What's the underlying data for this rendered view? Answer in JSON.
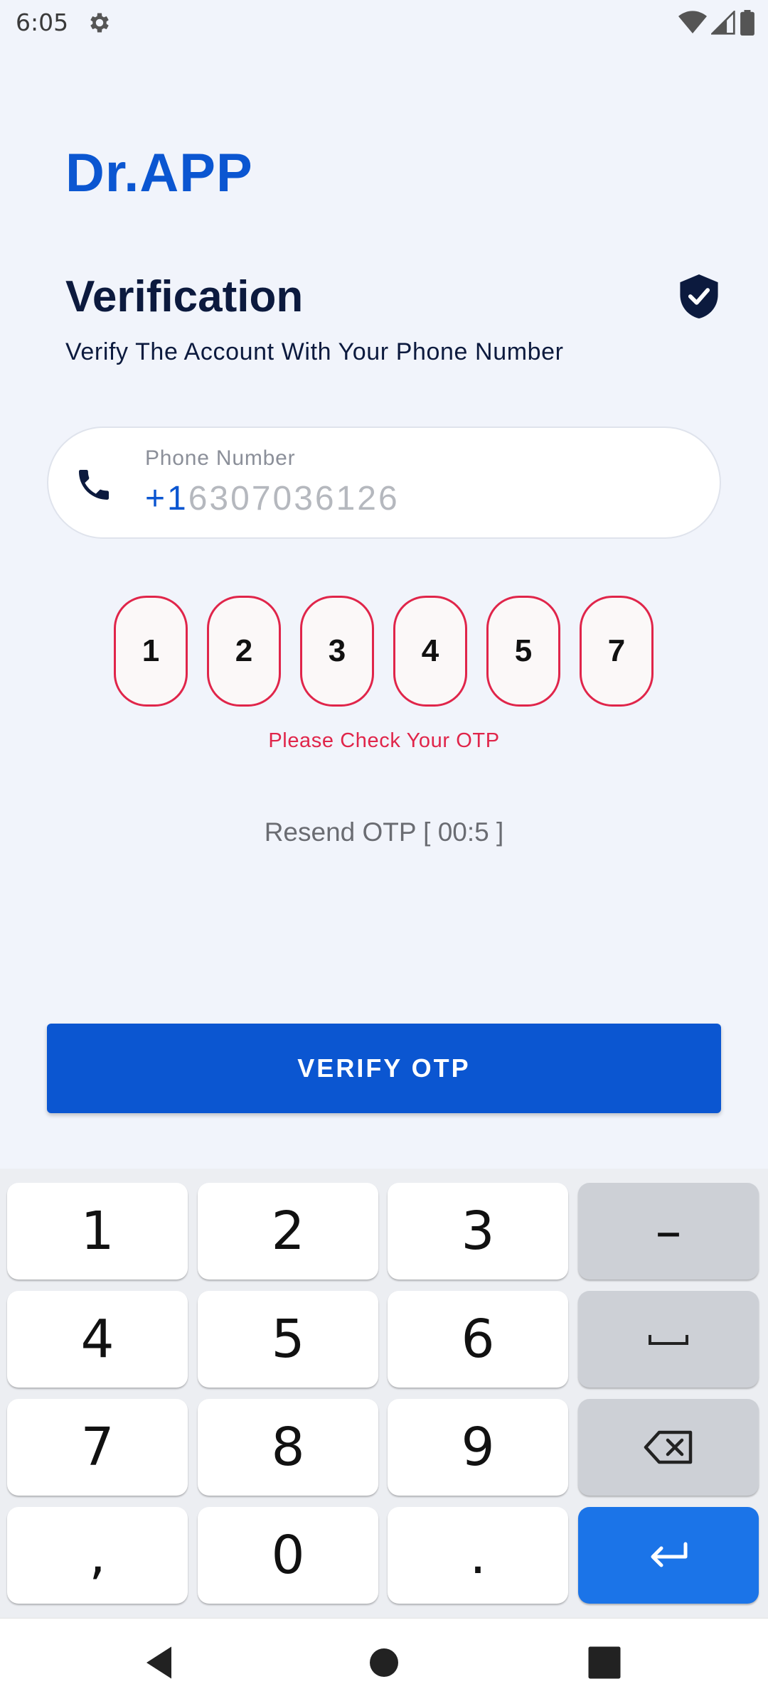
{
  "status_bar": {
    "time": "6:05"
  },
  "brand": {
    "name": "Dr.APP"
  },
  "verification": {
    "title": "Verification",
    "subtitle": "Verify The Account With Your Phone Number"
  },
  "phone": {
    "label": "Phone Number",
    "country_code": "+1",
    "number": "6307036126"
  },
  "otp": {
    "digits": [
      "1",
      "2",
      "3",
      "4",
      "5",
      "7"
    ],
    "error": "Please Check Your OTP"
  },
  "resend": {
    "label": "Resend OTP [ 00:5 ]"
  },
  "verify_button": {
    "label": "VERIFY OTP"
  },
  "keyboard": {
    "keys": [
      "1",
      "2",
      "3",
      "4",
      "5",
      "6",
      "7",
      "8",
      "9",
      ",",
      "0",
      "."
    ],
    "minus": "–"
  },
  "colors": {
    "brand": "#0b56d1",
    "error": "#e0254a",
    "enter_key": "#1b74e8",
    "background": "#f1f4fb"
  }
}
